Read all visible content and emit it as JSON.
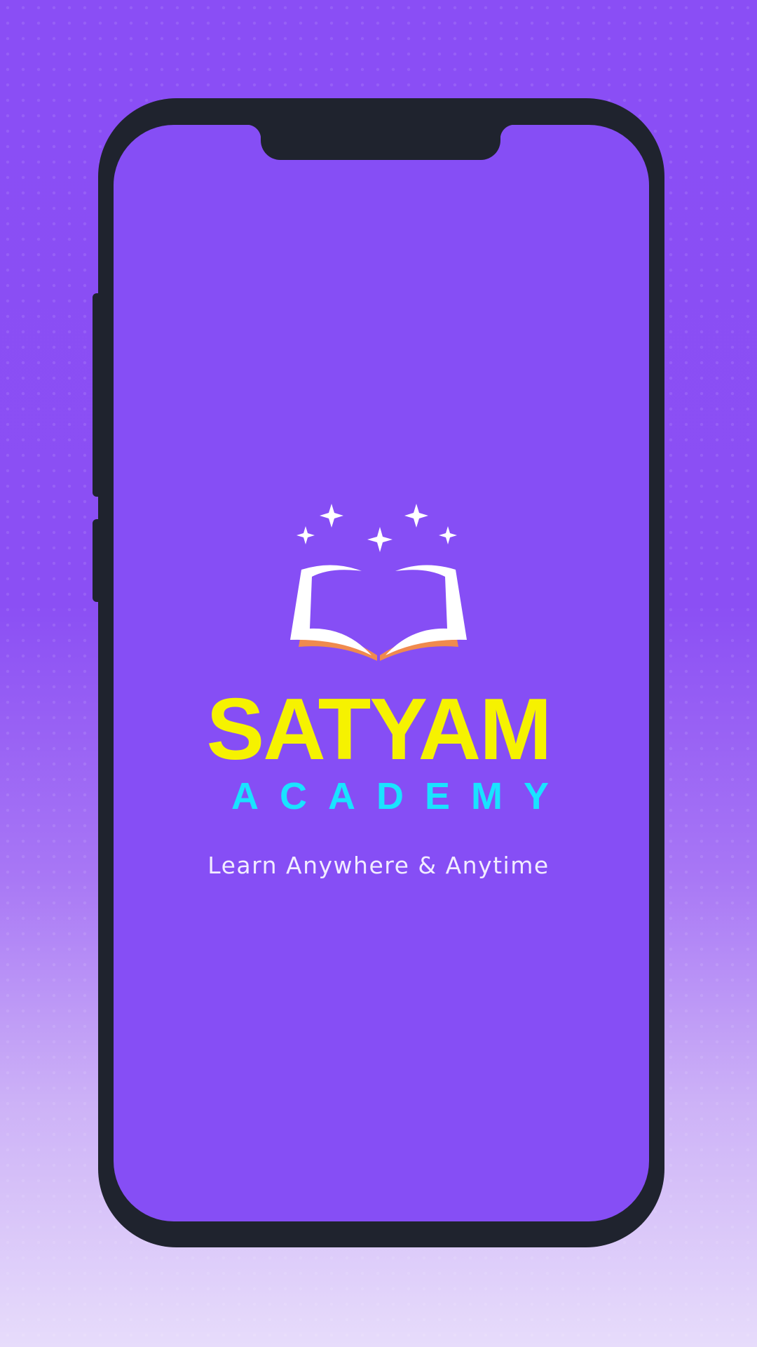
{
  "splash": {
    "brand_name": "SATYAM",
    "brand_subtitle": "ACADEMY",
    "tagline": "Learn Anywhere & Anytime"
  },
  "colors": {
    "screen_background": "#864ef5",
    "brand_name": "#f6f200",
    "brand_subtitle": "#19e3ff",
    "tagline": "#f2ecff",
    "book_pages": "#ffffff",
    "book_cover": "#f08a4e",
    "stars": "#ffffff",
    "device_frame": "#1f232e"
  },
  "icons": {
    "logo": "open-book-with-stars-icon"
  }
}
